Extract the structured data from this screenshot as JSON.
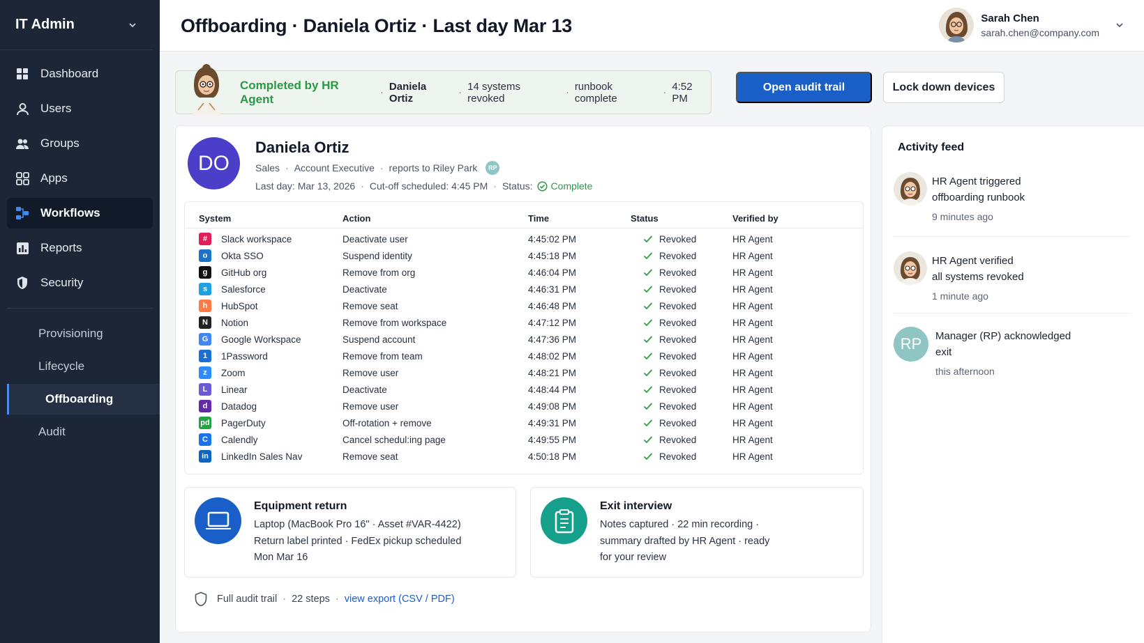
{
  "sidebar": {
    "org": "IT Admin",
    "nav": [
      {
        "label": "Dashboard",
        "icon": "dashboard-icon"
      },
      {
        "label": "Users",
        "icon": "user-icon"
      },
      {
        "label": "Groups",
        "icon": "groups-icon"
      },
      {
        "label": "Apps",
        "icon": "apps-icon"
      },
      {
        "label": "Workflows",
        "icon": "workflows-icon",
        "active": true
      },
      {
        "label": "Reports",
        "icon": "reports-icon"
      },
      {
        "label": "Security",
        "icon": "shield-icon"
      }
    ],
    "sub": [
      {
        "label": "Provisioning"
      },
      {
        "label": "Lifecycle"
      },
      {
        "label": "Offboarding",
        "active": true
      },
      {
        "label": "Audit"
      }
    ]
  },
  "header": {
    "title": "Offboarding · Daniela Ortiz · Last day Mar 13",
    "user_name": "Sarah Chen",
    "user_email": "sarah.chen@company.com"
  },
  "banner": {
    "status": "Completed by HR Agent",
    "employee": "Daniela Ortiz",
    "systems": "14 systems revoked",
    "runbook": "runbook complete",
    "time": "4:52 PM"
  },
  "actions": {
    "primary": "Open audit trail",
    "secondary": "Lock down devices"
  },
  "employee": {
    "initials": "DO",
    "name": "Daniela Ortiz",
    "dept": "Sales",
    "role": "Account Executive",
    "reports_to": "reports to Riley Park",
    "manager_initials": "RP",
    "last_day": "Last day: Mar 13, 2026",
    "cutoff": "Cut-off scheduled: 4:45 PM",
    "status_label": "Status:",
    "status": "Complete"
  },
  "table": {
    "headers": [
      "System",
      "Action",
      "Time",
      "Status",
      "Verified by"
    ],
    "rows": [
      {
        "system": "Slack workspace",
        "action": "Deactivate user",
        "time": "4:45:02 PM",
        "status": "Revoked",
        "verified": "HR Agent",
        "icon": "slack-icon",
        "color": "#e01e5a",
        "glyph": "#"
      },
      {
        "system": "Okta SSO",
        "action": "Suspend identity",
        "time": "4:45:18 PM",
        "status": "Revoked",
        "verified": "HR Agent",
        "icon": "okta-icon",
        "color": "#1a73c8",
        "glyph": "o"
      },
      {
        "system": "GitHub org",
        "action": "Remove from org",
        "time": "4:46:04 PM",
        "status": "Revoked",
        "verified": "HR Agent",
        "icon": "github-icon",
        "color": "#111111",
        "glyph": "g"
      },
      {
        "system": "Salesforce",
        "action": "Deactivate",
        "time": "4:46:31 PM",
        "status": "Revoked",
        "verified": "HR Agent",
        "icon": "salesforce-icon",
        "color": "#1fa0e0",
        "glyph": "s"
      },
      {
        "system": "HubSpot",
        "action": "Remove seat",
        "time": "4:46:48 PM",
        "status": "Revoked",
        "verified": "HR Agent",
        "icon": "hubspot-icon",
        "color": "#ff7a45",
        "glyph": "h"
      },
      {
        "system": "Notion",
        "action": "Remove from workspace",
        "time": "4:47:12 PM",
        "status": "Revoked",
        "verified": "HR Agent",
        "icon": "notion-icon",
        "color": "#222222",
        "glyph": "N"
      },
      {
        "system": "Google Workspace",
        "action": "Suspend account",
        "time": "4:47:36 PM",
        "status": "Revoked",
        "verified": "HR Agent",
        "icon": "google-icon",
        "color": "#4285f4",
        "glyph": "G"
      },
      {
        "system": "1Password",
        "action": "Remove from team",
        "time": "4:48:02 PM",
        "status": "Revoked",
        "verified": "HR Agent",
        "icon": "onepassword-icon",
        "color": "#1a6fd1",
        "glyph": "1"
      },
      {
        "system": "Zoom",
        "action": "Remove user",
        "time": "4:48:21 PM",
        "status": "Revoked",
        "verified": "HR Agent",
        "icon": "zoom-icon",
        "color": "#2d8cff",
        "glyph": "z"
      },
      {
        "system": "Linear",
        "action": "Deactivate",
        "time": "4:48:44 PM",
        "status": "Revoked",
        "verified": "HR Agent",
        "icon": "linear-icon",
        "color": "#6b5bd6",
        "glyph": "L"
      },
      {
        "system": "Datadog",
        "action": "Remove user",
        "time": "4:49:08 PM",
        "status": "Revoked",
        "verified": "HR Agent",
        "icon": "datadog-icon",
        "color": "#632ca6",
        "glyph": "d"
      },
      {
        "system": "PagerDuty",
        "action": "Off-rotation + remove",
        "time": "4:49:31 PM",
        "status": "Revoked",
        "verified": "HR Agent",
        "icon": "pagerduty-icon",
        "color": "#25a244",
        "glyph": "pd"
      },
      {
        "system": "Calendly",
        "action": "Cancel schedul:ing page",
        "time": "4:49:55 PM",
        "status": "Revoked",
        "verified": "HR Agent",
        "icon": "calendly-icon",
        "color": "#1a73e8",
        "glyph": "C"
      },
      {
        "system": "LinkedIn Sales Nav",
        "action": "Remove seat",
        "time": "4:50:18 PM",
        "status": "Revoked",
        "verified": "HR Agent",
        "icon": "linkedin-icon",
        "color": "#0a66c2",
        "glyph": "in"
      }
    ]
  },
  "equipment": {
    "title": "Equipment return",
    "line1": "Laptop (MacBook Pro 16\"  ·  Asset #VAR-4422)",
    "line2": "Return label printed  ·  FedEx pickup scheduled",
    "line3": "Mon Mar 16"
  },
  "exit": {
    "title": "Exit interview",
    "line1": "Notes captured  ·  22 min recording  ·",
    "line2": "summary drafted by HR Agent  ·  ready",
    "line3": "for your review"
  },
  "audit": {
    "label": "Full audit trail",
    "steps": "22 steps",
    "link": "view export (CSV / PDF)"
  },
  "feed": {
    "title": "Activity feed",
    "items": [
      {
        "line1": "HR Agent triggered",
        "line2": "offboarding runbook",
        "time": "9 minutes ago"
      },
      {
        "line1": "HR Agent verified",
        "line2": "all systems revoked",
        "time": "1 minute ago"
      },
      {
        "line1": "Manager (RP) acknowledged",
        "line2": "exit",
        "time": "this afternoon",
        "initials": "RP"
      }
    ]
  },
  "colors": {
    "accent": "#1a5fc8",
    "success": "#2a9a46",
    "sidebar": "#1c2637",
    "employee_avatar": "#4b3fc9",
    "manager_avatar": "#8fc6c4"
  }
}
